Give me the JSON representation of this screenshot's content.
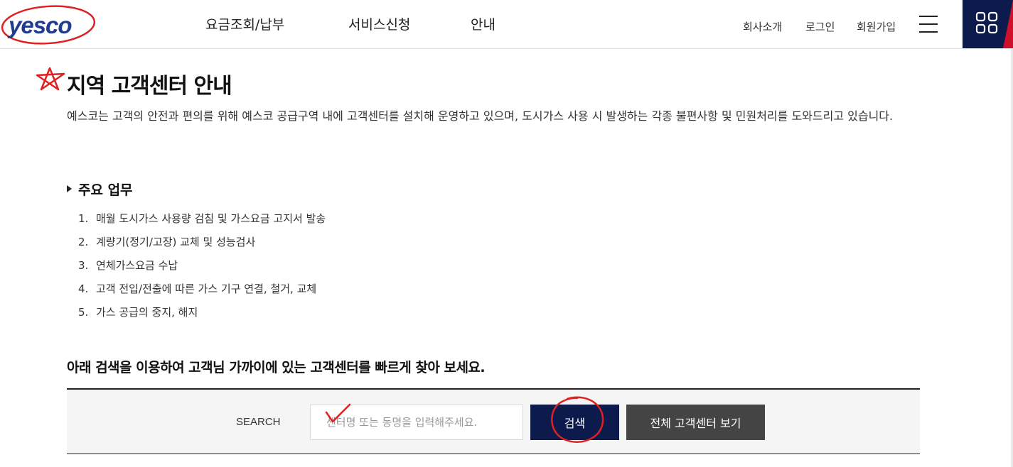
{
  "header": {
    "logo_text": "yesco",
    "nav": [
      "요금조회/납부",
      "서비스신청",
      "안내"
    ],
    "util": [
      "회사소개",
      "로그인",
      "회원가입"
    ],
    "icons": {
      "menu": "hamburger-icon",
      "apps": "apps-grid-icon"
    },
    "colors": {
      "brand_navy": "#0d1b4c",
      "brand_red": "#d0102a",
      "logo_blue": "#1f3c8f"
    }
  },
  "content": {
    "title": "지역 고객센터 안내",
    "intro": "예스코는 고객의 안전과 편의를 위해 예스코 공급구역 내에 고객센터를 설치해 운영하고 있으며, 도시가스 사용 시 발생하는 각종 불편사항 및 민원처리를 도와드리고 있습니다.",
    "duties_title": "주요 업무",
    "duties": [
      "매월 도시가스 사용량 검침 및 가스요금 고지서 발송",
      "계량기(정기/고장) 교체 및 성능검사",
      "연체가스요금 수납",
      "고객 전입/전출에 따른 가스 기구 연결, 철거, 교체",
      "가스 공급의 중지, 해지"
    ],
    "search_guide": "아래 검색을 이용하여 고객님 가까이에 있는 고객센터를 빠르게 찾아 보세요."
  },
  "search": {
    "label": "SEARCH",
    "value": "",
    "placeholder": "센터명 또는 동명을 입력해주세요.",
    "search_button": "검색",
    "all_button": "전체 고객센터 보기"
  }
}
